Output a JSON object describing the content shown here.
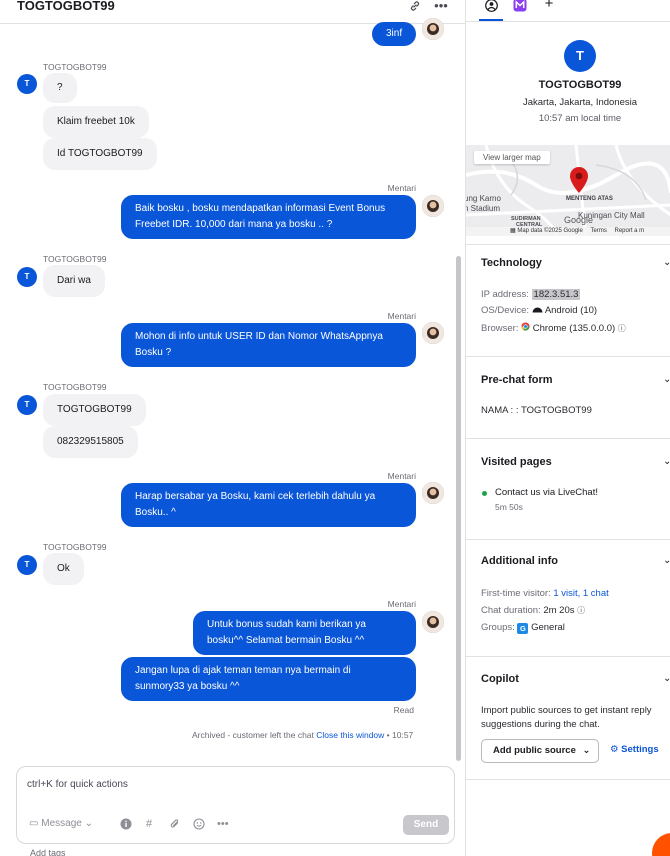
{
  "chat": {
    "title": "TOGTOGBOT99",
    "customer_initial": "T",
    "messages": {
      "m0": "3inf",
      "s1": "TOGTOGBOT99",
      "m1a": "?",
      "m1b": "Klaim freebet 10k",
      "m1c": "Id TOGTOGBOT99",
      "a1": "Mentari",
      "m2": "Baik bosku , bosku mendapatkan informasi Event Bonus Freebet IDR. 10,000 dari mana ya bosku .. ?",
      "s2": "TOGTOGBOT99",
      "m3": "Dari wa",
      "a2": "Mentari",
      "m4": "Mohon di info untuk USER ID dan Nomor WhatsAppnya Bosku ?",
      "s3": "TOGTOGBOT99",
      "m5a": "TOGTOGBOT99",
      "m5b": "082329515805",
      "a3": "Mentari",
      "m6": "Harap bersabar ya Bosku, kami cek terlebih dahulu ya Bosku.. ^",
      "s4": "TOGTOGBOT99",
      "m7": "Ok",
      "a4": "Mentari",
      "m8": "Untuk bonus sudah kami berikan ya bosku^^ Selamat bermain Bosku ^^",
      "m9": "Jangan lupa di ajak teman teman nya bermain di sunmory33 ya bosku ^^",
      "read": "Read"
    },
    "archived": {
      "text": "Archived - customer left the chat",
      "link": "Close this window",
      "time": "• 10:57"
    },
    "composer": {
      "placeholder": "ctrl+K for quick actions",
      "message_type": "Message",
      "send": "Send"
    },
    "bottom_peek": "Add tags"
  },
  "details": {
    "avatar_initial": "T",
    "name": "TOGTOGBOT99",
    "location": "Jakarta, Jakarta, Indonesia",
    "local_time": "10:57 am local time",
    "map": {
      "view_larger": "View larger map",
      "area_1": "MENTENG ATAS",
      "area_2": "Kuningan City Mall",
      "area_3": "ung Karno",
      "area_4": "n Stadium",
      "area_5": "SUDIRMAN",
      "area_6": "CENTRAL",
      "attribution": "Map data ©2025 Google",
      "terms": "Terms",
      "report": "Report a m",
      "google": "Google"
    },
    "technology": {
      "title": "Technology",
      "ip_label": "IP address:",
      "ip_value": "182.3.51.3",
      "os_label": "OS/Device:",
      "os_value": "Android (10)",
      "browser_label": "Browser:",
      "browser_value": "Chrome (135.0.0.0)"
    },
    "prechat": {
      "title": "Pre-chat form",
      "field": "NAMA : : TOGTOGBOT99"
    },
    "visited": {
      "title": "Visited pages",
      "page": "Contact us via LiveChat!",
      "duration": "5m 50s"
    },
    "additional": {
      "title": "Additional info",
      "first_label": "First-time visitor:",
      "first_value": "1 visit, 1 chat",
      "duration_label": "Chat duration:",
      "duration_value": "2m 20s",
      "groups_label": "Groups:",
      "groups_initial": "G",
      "groups_value": "General"
    },
    "copilot": {
      "title": "Copilot",
      "description": "Import public sources to get instant reply suggestions during the chat.",
      "add_source": "Add public source",
      "settings": "Settings"
    }
  },
  "colors": {
    "accent": "#0a56d8",
    "incoming_bubble": "#f2f2f4",
    "map_pin": "#d81c1c",
    "fab": "#ff5100"
  }
}
